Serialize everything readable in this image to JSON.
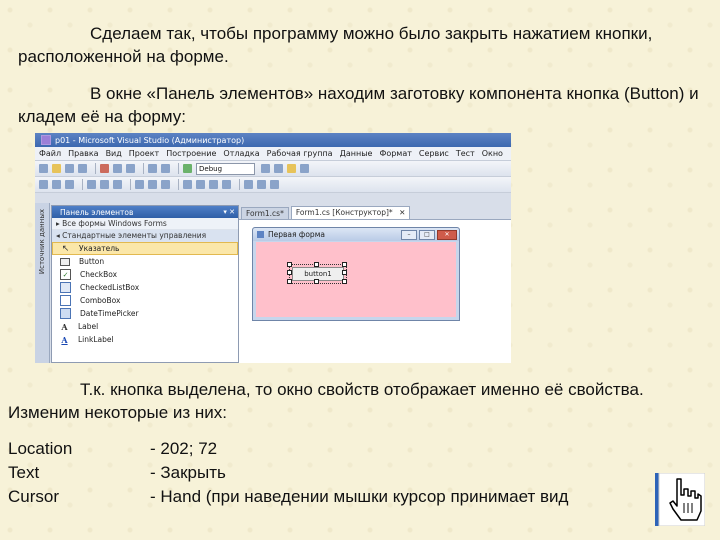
{
  "slide": {
    "paragraph1": "Сделаем так, чтобы программу можно было закрыть нажатием кнопки, расположенной на форме.",
    "paragraph2": "В окне «Панель элементов» находим заготовку компонента кнопка (Button) и кладем её на форму:",
    "paragraph3": "Т.к. кнопка выделена, то окно свойств отображает именно её свойства. Изменим некоторые из них:",
    "properties": [
      {
        "name": "Location",
        "value": "- 202; 72"
      },
      {
        "name": "Text",
        "value": "- Закрыть"
      },
      {
        "name": "Cursor",
        "value": "- Hand (при наведении мышки курсор принимает вид"
      }
    ]
  },
  "vs": {
    "title": "p01 - Microsoft Visual Studio (Администратор)",
    "menu": [
      "Файл",
      "Правка",
      "Вид",
      "Проект",
      "Построение",
      "Отладка",
      "Рабочая группа",
      "Данные",
      "Формат",
      "Сервис",
      "Тест",
      "Окно"
    ],
    "config": "Debug",
    "toolbox": {
      "title": "Панель элементов",
      "groups": [
        "▸ Все формы Windows Forms",
        "◂ Стандартные элементы управления"
      ],
      "items": [
        "Указатель",
        "Button",
        "CheckBox",
        "CheckedListBox",
        "ComboBox",
        "DateTimePicker",
        "Label",
        "LinkLabel"
      ]
    },
    "tabs": [
      "Form1.cs*",
      "Form1.cs [Конструктор]*"
    ],
    "form": {
      "title": "Первая форма",
      "button_text": "button1",
      "back_color": "#ffc0cb"
    },
    "side_tab": "Источник данных"
  }
}
